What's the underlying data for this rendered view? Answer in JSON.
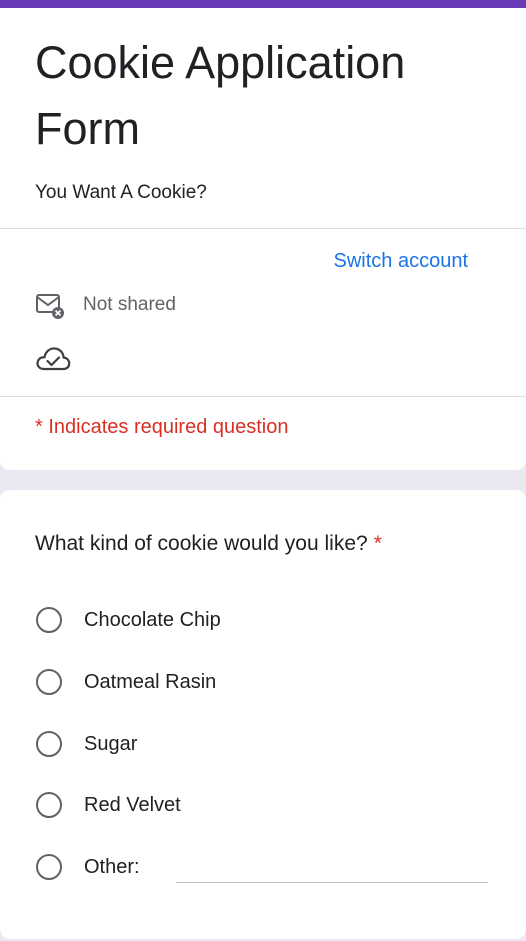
{
  "form": {
    "title": "Cookie Application Form",
    "description": "You Want A Cookie?",
    "switch_account": "Switch account",
    "not_shared": "Not shared",
    "required_note": "* Indicates required question",
    "icons": {
      "mail": "mail-x-icon",
      "cloud": "cloud-check-icon"
    }
  },
  "question": {
    "text": "What kind of cookie would you like?",
    "required_mark": "*",
    "options": [
      {
        "label": "Chocolate Chip"
      },
      {
        "label": "Oatmeal Rasin"
      },
      {
        "label": "Sugar"
      },
      {
        "label": "Red Velvet"
      },
      {
        "label": "Other:"
      }
    ]
  },
  "colors": {
    "accent": "#673ab7",
    "link": "#1a73e8",
    "required": "#d93025",
    "background": "#ebe8f1"
  }
}
